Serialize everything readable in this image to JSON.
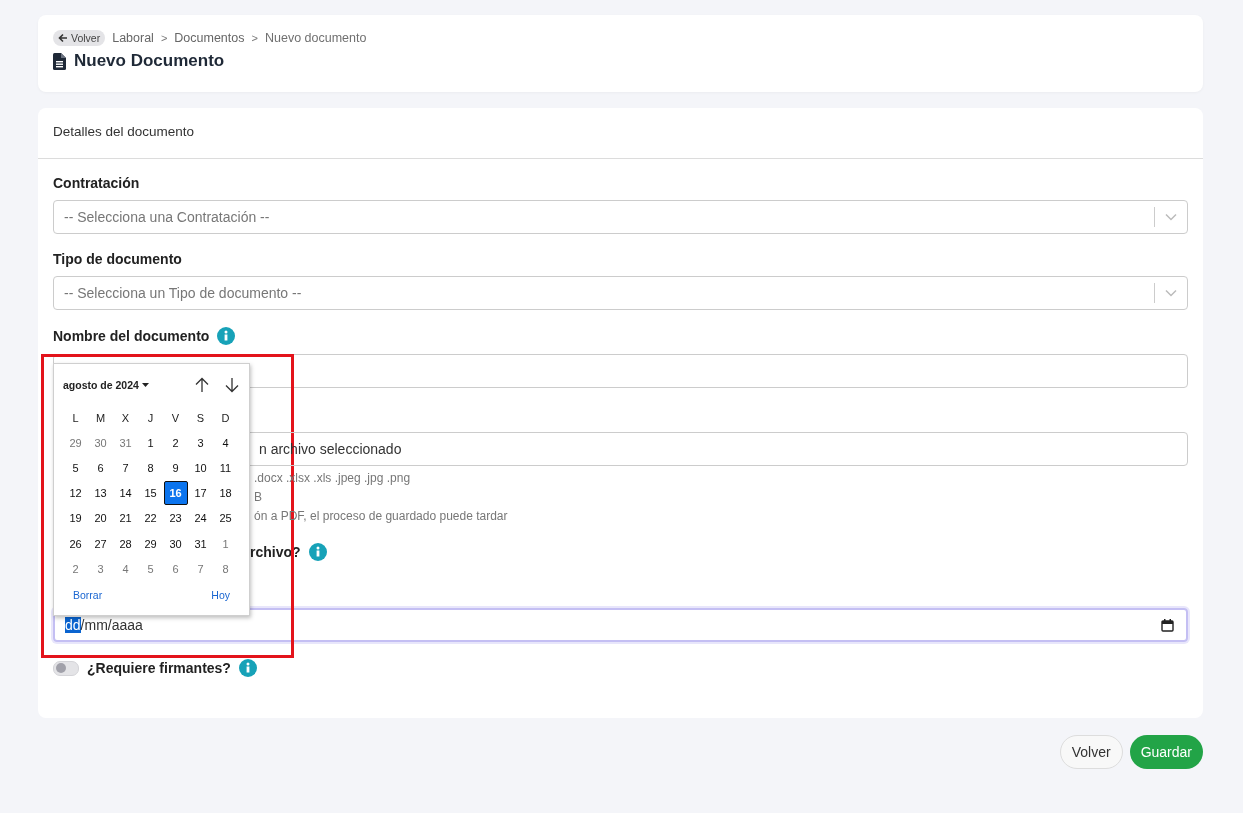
{
  "header": {
    "back_button": "Volver",
    "breadcrumb": [
      {
        "kind": "link",
        "text": "Laboral"
      },
      {
        "kind": "separator",
        "text": ">"
      },
      {
        "kind": "link",
        "text": "Documentos"
      },
      {
        "kind": "separator",
        "text": ">"
      },
      {
        "kind": "current",
        "text": "Nuevo documento"
      }
    ],
    "title": "Nuevo Documento"
  },
  "card": {
    "title": "Detalles del documento",
    "contratacion": {
      "label": "Contratación",
      "placeholder": "-- Selecciona una Contratación --"
    },
    "tipo": {
      "label": "Tipo de documento",
      "placeholder": "-- Selecciona un Tipo de documento --"
    },
    "nombre": {
      "label": "Nombre del documento"
    },
    "file": {
      "value": "n archivo seleccionado"
    },
    "file_hints": [
      ".docx .xlsx .xls .jpeg .jpg .png",
      "B",
      "ón a PDF, el proceso de guardado puede tardar"
    ],
    "question": {
      "label": "rchivo?"
    },
    "date": {
      "segments": [
        {
          "text": "dd",
          "selected": true
        },
        {
          "text": "/mm/aaaa",
          "selected": false
        }
      ]
    },
    "firmantes": {
      "label": "¿Requiere firmantes?",
      "on": false
    }
  },
  "calendar": {
    "month": "agosto de 2024",
    "weekdays": [
      "L",
      "M",
      "X",
      "J",
      "V",
      "S",
      "D"
    ],
    "weeks": [
      [
        {
          "label": "29",
          "outside": true,
          "selected": false
        },
        {
          "label": "30",
          "outside": true,
          "selected": false
        },
        {
          "label": "31",
          "outside": true,
          "selected": false
        },
        {
          "label": "1",
          "outside": false,
          "selected": false
        },
        {
          "label": "2",
          "outside": false,
          "selected": false
        },
        {
          "label": "3",
          "outside": false,
          "selected": false
        },
        {
          "label": "4",
          "outside": false,
          "selected": false
        }
      ],
      [
        {
          "label": "5",
          "outside": false,
          "selected": false
        },
        {
          "label": "6",
          "outside": false,
          "selected": false
        },
        {
          "label": "7",
          "outside": false,
          "selected": false
        },
        {
          "label": "8",
          "outside": false,
          "selected": false
        },
        {
          "label": "9",
          "outside": false,
          "selected": false
        },
        {
          "label": "10",
          "outside": false,
          "selected": false
        },
        {
          "label": "11",
          "outside": false,
          "selected": false
        }
      ],
      [
        {
          "label": "12",
          "outside": false,
          "selected": false
        },
        {
          "label": "13",
          "outside": false,
          "selected": false
        },
        {
          "label": "14",
          "outside": false,
          "selected": false
        },
        {
          "label": "15",
          "outside": false,
          "selected": false
        },
        {
          "label": "16",
          "outside": false,
          "selected": true
        },
        {
          "label": "17",
          "outside": false,
          "selected": false
        },
        {
          "label": "18",
          "outside": false,
          "selected": false
        }
      ],
      [
        {
          "label": "19",
          "outside": false,
          "selected": false
        },
        {
          "label": "20",
          "outside": false,
          "selected": false
        },
        {
          "label": "21",
          "outside": false,
          "selected": false
        },
        {
          "label": "22",
          "outside": false,
          "selected": false
        },
        {
          "label": "23",
          "outside": false,
          "selected": false
        },
        {
          "label": "24",
          "outside": false,
          "selected": false
        },
        {
          "label": "25",
          "outside": false,
          "selected": false
        }
      ],
      [
        {
          "label": "26",
          "outside": false,
          "selected": false
        },
        {
          "label": "27",
          "outside": false,
          "selected": false
        },
        {
          "label": "28",
          "outside": false,
          "selected": false
        },
        {
          "label": "29",
          "outside": false,
          "selected": false
        },
        {
          "label": "30",
          "outside": false,
          "selected": false
        },
        {
          "label": "31",
          "outside": false,
          "selected": false
        },
        {
          "label": "1",
          "outside": true,
          "selected": false
        }
      ],
      [
        {
          "label": "2",
          "outside": true,
          "selected": false
        },
        {
          "label": "3",
          "outside": true,
          "selected": false
        },
        {
          "label": "4",
          "outside": true,
          "selected": false
        },
        {
          "label": "5",
          "outside": true,
          "selected": false
        },
        {
          "label": "6",
          "outside": true,
          "selected": false
        },
        {
          "label": "7",
          "outside": true,
          "selected": false
        },
        {
          "label": "8",
          "outside": true,
          "selected": false
        }
      ]
    ],
    "clear": "Borrar",
    "today": "Hoy"
  },
  "actions": {
    "back": "Volver",
    "save": "Guardar"
  }
}
